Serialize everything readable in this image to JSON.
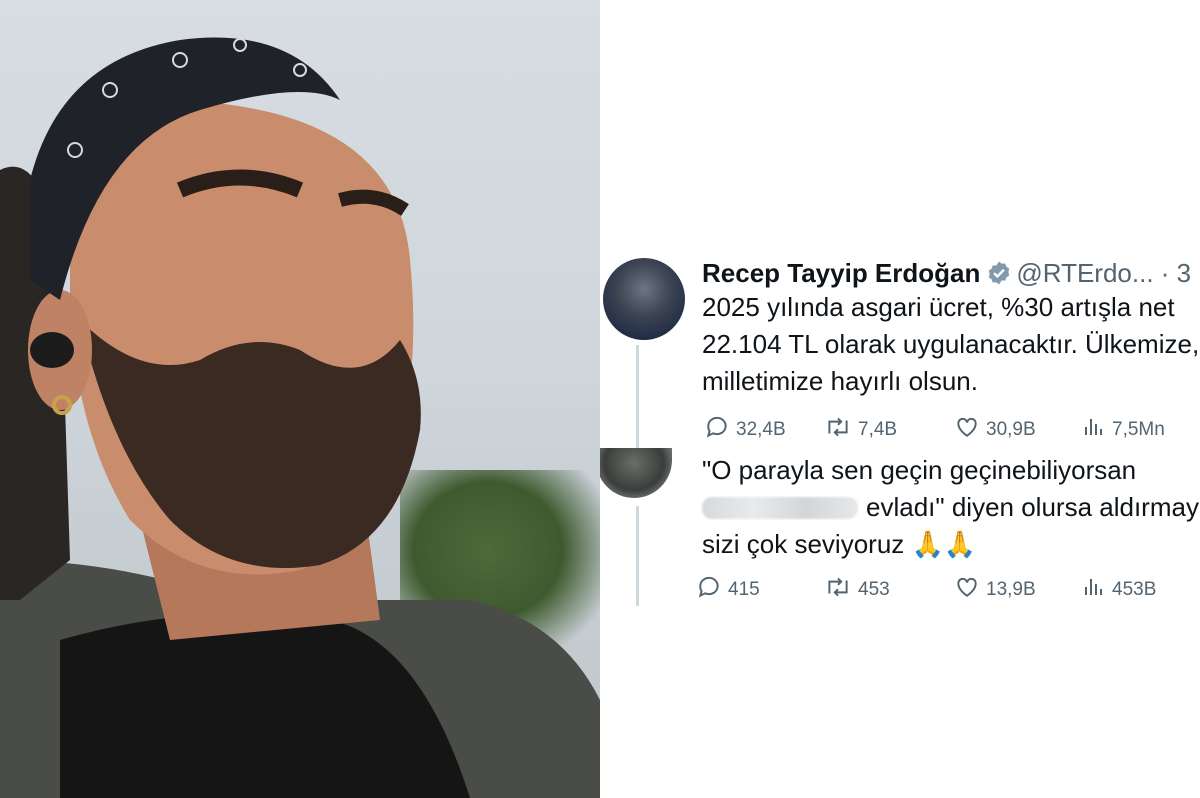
{
  "main_tweet": {
    "author_name": "Recep Tayyip Erdoğan",
    "handle": "@RTErdo... · 3",
    "lines": [
      "2025 yılında asgari ücret, %30 artışla net",
      "22.104 TL olarak uygulanacaktır. Ülkemize,",
      "milletimize hayırlı olsun."
    ],
    "stats": {
      "replies": "32,4B",
      "reposts": "7,4B",
      "likes": "30,9B",
      "views": "7,5Mn"
    }
  },
  "reply_tweet": {
    "line1": "\"O parayla sen geçin geçinebiliyorsan",
    "line2": "evladı\" diyen olursa aldırmayın",
    "line3": "sizi çok seviyoruz 🙏🙏",
    "stats": {
      "replies": "415",
      "reposts": "453",
      "likes": "13,9B",
      "views": "453B"
    }
  },
  "icons": {
    "verified": "verified-badge-icon",
    "reply": "reply-bubble-icon",
    "repost": "repost-icon",
    "like": "heart-icon",
    "views": "views-bar-icon"
  },
  "colors": {
    "text": "#0f1419",
    "secondary": "#536471",
    "verified": "#829aab"
  }
}
